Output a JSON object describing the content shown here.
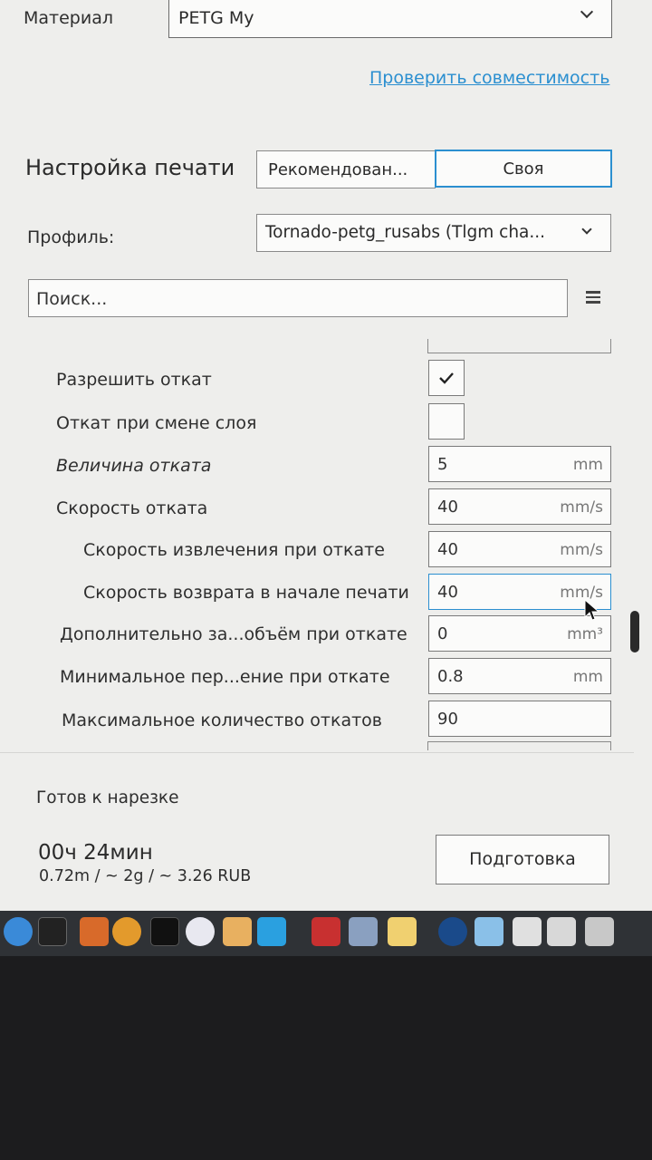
{
  "material": {
    "label": "Материал",
    "value": "PETG My"
  },
  "compat_link": "Проверить совместимость",
  "print_setup": {
    "title": "Настройка печати",
    "tabs": [
      {
        "label": "Рекомендован..."
      },
      {
        "label": "Своя"
      }
    ]
  },
  "profile": {
    "label": "Профиль:",
    "value": "Tornado-petg_rusabs (Tlgm cha..."
  },
  "search": {
    "placeholder": "Поиск..."
  },
  "settings": [
    {
      "label": "Разрешить откат",
      "type": "checkbox",
      "checked": true
    },
    {
      "label": "Откат при смене слоя",
      "type": "checkbox",
      "checked": false
    },
    {
      "label": "Величина отката",
      "type": "number",
      "value": "5",
      "unit": "mm"
    },
    {
      "label": "Скорость отката",
      "type": "number",
      "value": "40",
      "unit": "mm/s"
    },
    {
      "label": "Скорость извлечения при откате",
      "type": "number",
      "value": "40",
      "unit": "mm/s"
    },
    {
      "label": "Скорость возврата в начале печати",
      "type": "number",
      "value": "40",
      "unit": "mm/s"
    },
    {
      "label": "Дополнительно за...объём при откате",
      "type": "number",
      "value": "0",
      "unit": "mm³"
    },
    {
      "label": "Минимальное пер...ение при откате",
      "type": "number",
      "value": "0.8",
      "unit": "mm"
    },
    {
      "label": "Максимальное количество откатов",
      "type": "number",
      "value": "90",
      "unit": ""
    }
  ],
  "status": {
    "ready_text": "Готов к нарезке",
    "time": "00ч 24мин",
    "details": "0.72m / ~ 2g / ~ 3.26 RUB",
    "prepare_button": "Подготовка"
  },
  "colors": {
    "accent_blue": "#2b8fd0",
    "panel_bg": "#eeeeec"
  },
  "dock_icons": [
    "finder-icon",
    "console-icon",
    "books-icon",
    "photos-icon",
    "terminal-icon",
    "itunes-icon",
    "font-icon",
    "app-c-icon",
    "presentation-icon",
    "preview-icon",
    "notes-icon",
    "onepassword-icon",
    "folder-icon",
    "document-icon",
    "image-icon",
    "trash-icon"
  ]
}
